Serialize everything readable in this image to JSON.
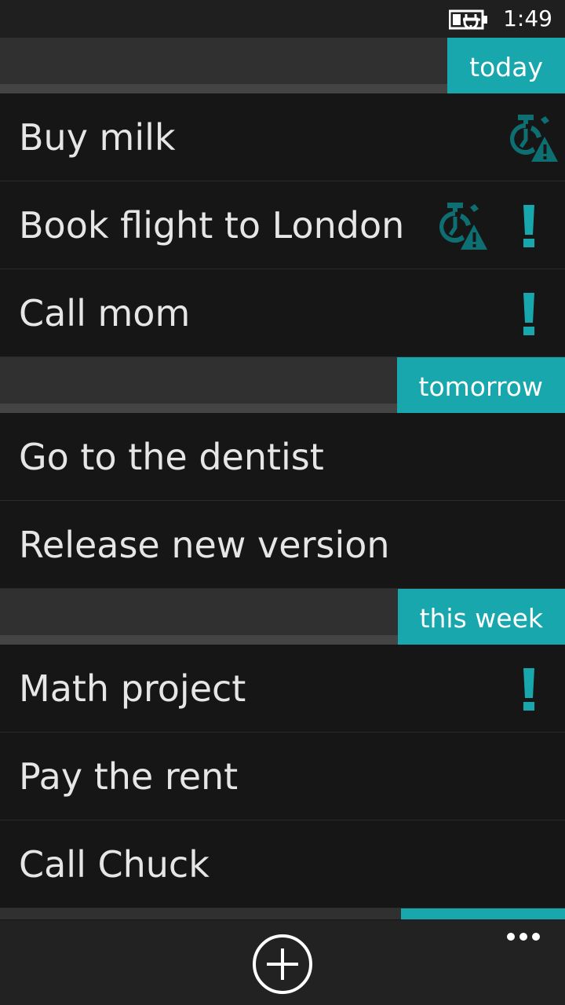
{
  "status_bar": {
    "time": "1:49",
    "battery_icon": "battery-charging-icon"
  },
  "colors": {
    "accent": "#17a7ad",
    "background": "#161616",
    "header_bg": "#303030"
  },
  "groups": [
    {
      "label": "today",
      "tasks": [
        {
          "title": "Buy milk",
          "overdue_alarm": true,
          "high_priority": false
        },
        {
          "title": "Book flight to London",
          "overdue_alarm": true,
          "high_priority": true
        },
        {
          "title": "Call mom",
          "overdue_alarm": false,
          "high_priority": true
        }
      ]
    },
    {
      "label": "tomorrow",
      "tasks": [
        {
          "title": "Go to the dentist",
          "overdue_alarm": false,
          "high_priority": false
        },
        {
          "title": "Release new version",
          "overdue_alarm": false,
          "high_priority": false
        }
      ]
    },
    {
      "label": "this week",
      "tasks": [
        {
          "title": "Math project",
          "overdue_alarm": false,
          "high_priority": true
        },
        {
          "title": "Pay the rent",
          "overdue_alarm": false,
          "high_priority": false
        },
        {
          "title": "Call Chuck",
          "overdue_alarm": false,
          "high_priority": false
        }
      ]
    }
  ],
  "app_bar": {
    "add_icon": "add-circle-icon",
    "more_icon": "more-dots-icon"
  }
}
